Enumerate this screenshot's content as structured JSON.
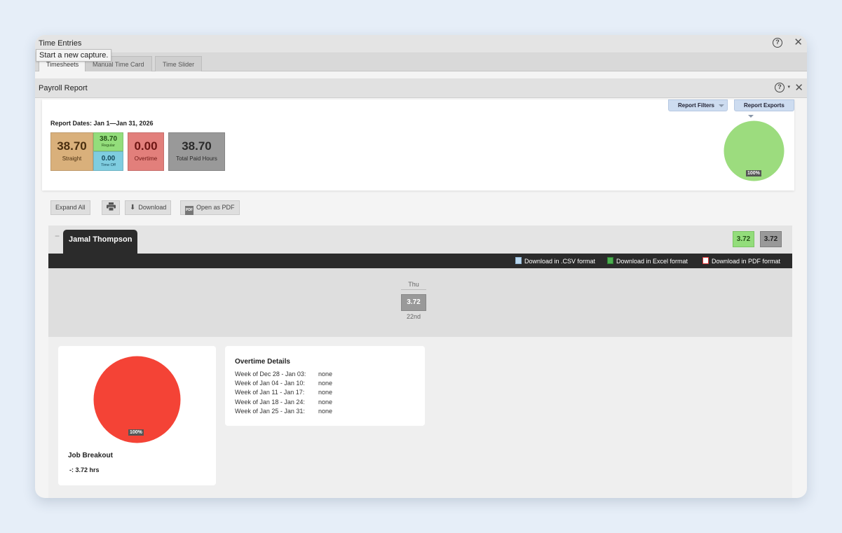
{
  "window": {
    "title": "Time Entries"
  },
  "tooltip": "Start a new capture.",
  "tabs": [
    "Timesheets",
    "Manual Time Card",
    "Time Slider"
  ],
  "panel": {
    "title": "Payroll Report"
  },
  "filters": {
    "report_filters": "Report Filters",
    "report_exports": "Report Exports"
  },
  "summary": {
    "report_dates": "Report Dates: Jan 1—Jan 31, 2026",
    "straight": {
      "value": "38.70",
      "label": "Straight"
    },
    "regular": {
      "value": "38.70",
      "label": "Regular"
    },
    "time_off": {
      "value": "0.00",
      "label": "Time Off"
    },
    "overtime": {
      "value": "0.00",
      "label": "Overtime"
    },
    "total_paid": {
      "value": "38.70",
      "label": "Total Paid Hours"
    },
    "pie": {
      "label": "100%",
      "color": "#9cdc7e",
      "fraction": 1.0
    }
  },
  "toolbar": {
    "expand_all": "Expand All",
    "download": "Download",
    "open_pdf": "Open as PDF"
  },
  "employee": {
    "name": "Jamal Thompson",
    "collapse": "−",
    "hours_regular": "3.72",
    "hours_total": "3.72"
  },
  "exports": {
    "csv": "Download in .CSV format",
    "excel": "Download in Excel format",
    "pdf": "Download in PDF format"
  },
  "day": {
    "dow": "Thu",
    "value": "3.72",
    "date": "22nd"
  },
  "job_breakout": {
    "title": "Job Breakout",
    "line": "-: 3.72 hrs",
    "pie": {
      "label": "100%",
      "color": "#f44336",
      "fraction": 1.0
    }
  },
  "overtime_details": {
    "title": "Overtime Details",
    "rows": [
      {
        "week": "Week of Dec 28 - Jan 03:",
        "value": "none"
      },
      {
        "week": "Week of Jan 04 - Jan 10:",
        "value": "none"
      },
      {
        "week": "Week of Jan 11 - Jan 17:",
        "value": "none"
      },
      {
        "week": "Week of Jan 18 - Jan 24:",
        "value": "none"
      },
      {
        "week": "Week of Jan 25 - Jan 31:",
        "value": "none"
      }
    ]
  },
  "icons": {
    "help": "help-icon",
    "close": "close-icon",
    "print": "print-icon",
    "download": "download-icon",
    "pdf": "pdf-icon"
  }
}
